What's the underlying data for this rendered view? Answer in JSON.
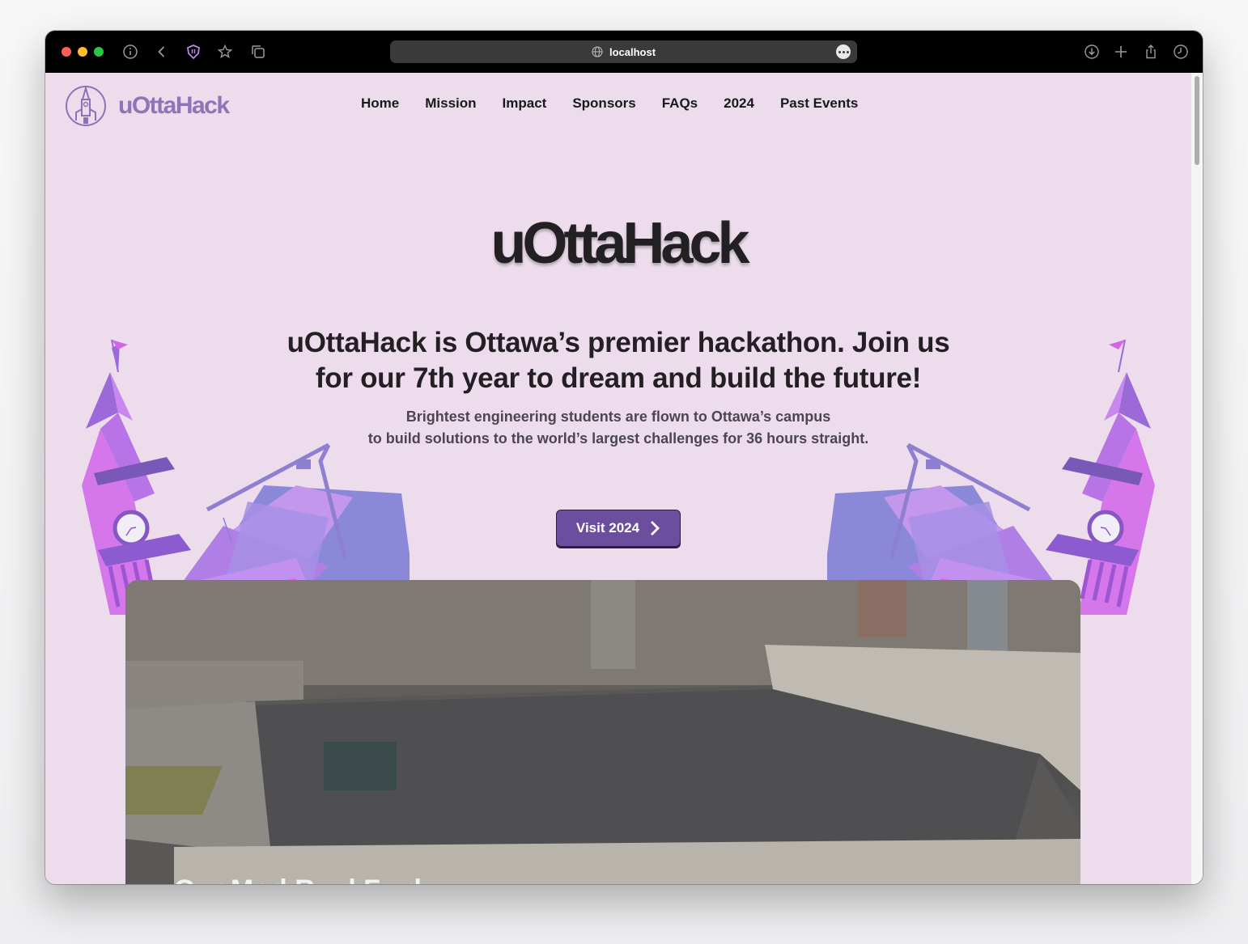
{
  "browser": {
    "url": "localhost"
  },
  "site": {
    "logo_text": "uOttaHack",
    "nav": [
      "Home",
      "Mission",
      "Impact",
      "Sponsors",
      "FAQs",
      "2024",
      "Past Events"
    ]
  },
  "hero": {
    "title": "uOttaHack",
    "headline": "uOttaHack is Ottawa’s premier hackathon. Join us for our 7th year to dream and build the future!",
    "subline_1": "Brightest engineering students are flown to Ottawa’s campus",
    "subline_2": "to build solutions to the world’s largest challenges for 36 hours straight.",
    "cta_label": "Visit 2024"
  },
  "video": {
    "caption": "Our Mod Ru d Fu d"
  },
  "colors": {
    "page_bg": "#ecdcec",
    "brand_purple": "#9273b8",
    "button": "#6b4f9e"
  }
}
